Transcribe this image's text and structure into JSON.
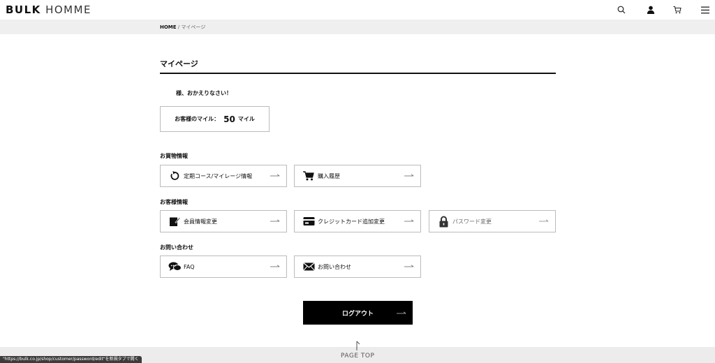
{
  "header": {
    "logo_bold": "BULK",
    "logo_light": "HOMME"
  },
  "breadcrumb": {
    "home": "HOME",
    "separator": "/",
    "current": "マイページ"
  },
  "page": {
    "title": "マイページ",
    "welcome": "様、おかえりなさい！"
  },
  "miles": {
    "label": "お客様のマイル：",
    "value": "50",
    "unit": "マイル"
  },
  "sections": {
    "shopping": {
      "title": "お買物情報",
      "items": [
        {
          "label": "定期コース/マイレージ情報",
          "icon": "refresh-icon"
        },
        {
          "label": "購入履歴",
          "icon": "cart-icon"
        }
      ]
    },
    "customer": {
      "title": "お客様情報",
      "items": [
        {
          "label": "会員情報変更",
          "icon": "edit-notebook-icon"
        },
        {
          "label": "クレジットカード追加変更",
          "icon": "credit-card-icon"
        },
        {
          "label": "パスワード変更",
          "icon": "lock-icon"
        }
      ]
    },
    "contact": {
      "title": "お問い合わせ",
      "items": [
        {
          "label": "FAQ",
          "icon": "chat-bubbles-icon"
        },
        {
          "label": "お問い合わせ",
          "icon": "envelope-icon"
        }
      ]
    }
  },
  "logout": {
    "label": "ログアウト"
  },
  "footer": {
    "page_top": "PAGE TOP"
  },
  "status_bar": {
    "text": "\"https://bulk.co.jp/shop/customer/password/edit\"を新規タブで開く"
  }
}
